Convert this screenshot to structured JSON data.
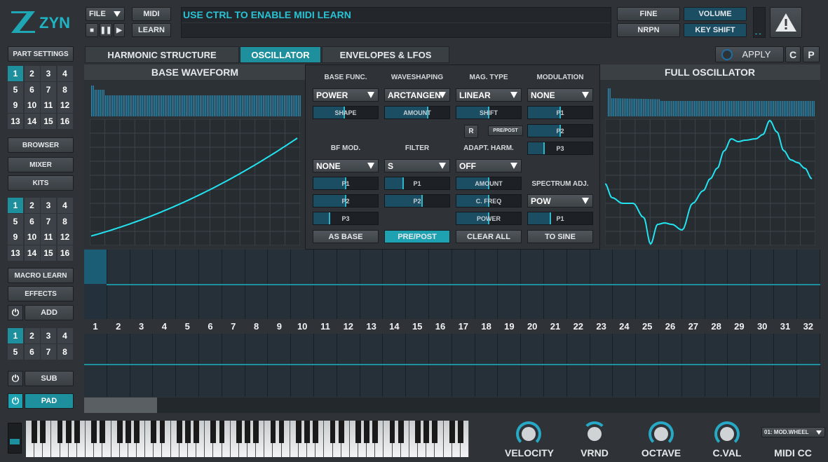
{
  "logo": {
    "text": "ZYN"
  },
  "topbar": {
    "file": "FILE",
    "midi": "MIDI",
    "learn": "LEARN",
    "message": "USE CTRL TO ENABLE MIDI LEARN",
    "fine": "FINE",
    "volume": "VOLUME",
    "nrpn": "NRPN",
    "key_shift": "KEY SHIFT",
    "meter": "- -"
  },
  "transport": {
    "stop": "■",
    "pause": "❚❚",
    "play": "▶"
  },
  "left": {
    "part_settings": "PART SETTINGS",
    "parts": [
      "1",
      "2",
      "3",
      "4",
      "5",
      "6",
      "7",
      "8",
      "9",
      "10",
      "11",
      "12",
      "13",
      "14",
      "15",
      "16"
    ],
    "browser": "BROWSER",
    "mixer": "MIXER",
    "kits": "KITS",
    "kit_items": [
      "1",
      "2",
      "3",
      "4",
      "5",
      "6",
      "7",
      "8",
      "9",
      "10",
      "11",
      "12",
      "13",
      "14",
      "15",
      "16"
    ],
    "macro_learn": "MACRO LEARN",
    "effects": "EFFECTS",
    "add": "ADD",
    "fx_items": [
      "1",
      "2",
      "3",
      "4",
      "5",
      "6",
      "7",
      "8"
    ],
    "sub": "SUB",
    "pad": "PAD"
  },
  "tabs": {
    "harmonic": "HARMONIC STRUCTURE",
    "oscillator": "OSCILLATOR",
    "envelopes": "ENVELOPES & LFOS",
    "apply": "APPLY",
    "c": "C",
    "p": "P"
  },
  "base": {
    "title": "BASE WAVEFORM"
  },
  "full": {
    "title": "FULL OSCILLATOR"
  },
  "controls": {
    "base_func": {
      "label": "BASE FUNC.",
      "value": "POWER",
      "slider": "SHAPE",
      "slider_value": 0.48
    },
    "waveshaping": {
      "label": "WAVESHAPING",
      "value": "ARCTANGEN",
      "slider": "AMOUNT",
      "slider_value": 0.66
    },
    "mag_type": {
      "label": "MAG. TYPE",
      "value": "LINEAR",
      "slider": "SHIFT",
      "slider_value": 0.5,
      "r": "R",
      "prepost": "PRE/POST"
    },
    "modulation": {
      "label": "MODULATION",
      "value": "NONE",
      "p1": "P1",
      "p1_value": 0.5,
      "p2": "P2",
      "p2_value": 0.5,
      "p3": "P3",
      "p3_value": 0.25
    },
    "bf_mod": {
      "label": "BF MOD.",
      "value": "NONE",
      "p1": "P1",
      "p1_value": 0.5,
      "p2": "P2",
      "p2_value": 0.5,
      "p3": "P3",
      "p3_value": 0.25
    },
    "filter": {
      "label": "FILTER",
      "value": "S",
      "p1": "P1",
      "p1_value": 0.28,
      "p2": "P2",
      "p2_value": 0.58
    },
    "adapt_harm": {
      "label": "ADAPT. HARM.",
      "value": "OFF",
      "amount": "AMOUNT",
      "amount_value": 0.5,
      "c_freq": "C. FREQ",
      "c_freq_value": 0.5,
      "power": "POWER",
      "power_value": 0.5
    },
    "spectrum_adj": {
      "label": "SPECTRUM ADJ.",
      "value": "POW",
      "p1": "P1",
      "p1_value": 0.35
    },
    "as_base": "AS BASE",
    "pre_post": "PRE/POST",
    "clear_all": "CLEAR ALL",
    "to_sine": "TO SINE"
  },
  "sequencer": {
    "columns": [
      "1",
      "2",
      "3",
      "4",
      "5",
      "6",
      "7",
      "8",
      "9",
      "10",
      "11",
      "12",
      "13",
      "14",
      "15",
      "16",
      "17",
      "18",
      "19",
      "20",
      "21",
      "22",
      "23",
      "24",
      "25",
      "26",
      "27",
      "28",
      "29",
      "30",
      "31",
      "32"
    ]
  },
  "bottom": {
    "velocity": "VELOCITY",
    "vrnd": "VRND",
    "octave": "OCTAVE",
    "cval": "C.VAL",
    "midi_cc": "MIDI CC",
    "midi_cc_select": "01: MOD.WHEEL"
  },
  "colors": {
    "accent": "#1e8f9c",
    "wave": "#22e3ef",
    "bg": "#2f3337"
  }
}
